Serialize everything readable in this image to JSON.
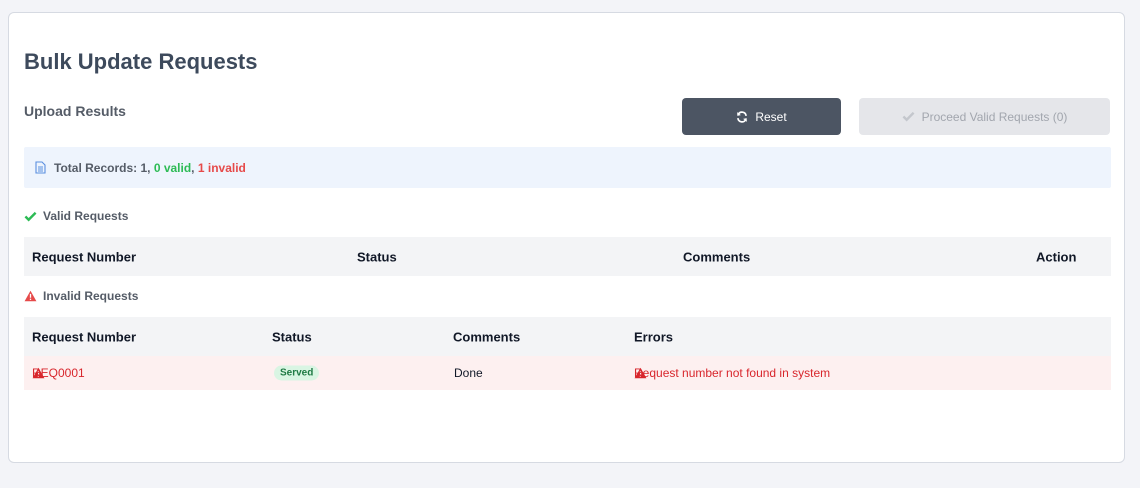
{
  "page": {
    "title": "Bulk Update Requests",
    "subtitle": "Upload Results"
  },
  "toolbar": {
    "reset_label": "Reset",
    "reset_icon": "refresh-icon",
    "proceed_label": "Proceed Valid Requests (0)",
    "proceed_icon": "check-icon",
    "proceed_disabled": true
  },
  "summary": {
    "icon": "document-icon",
    "prefix": "Total Records: 1,",
    "valid": "0 valid",
    "sep": ",",
    "invalid": "1 invalid"
  },
  "valid_section": {
    "title": "Valid Requests",
    "icon": "check-icon",
    "columns": [
      "Request Number",
      "Status",
      "Comments",
      "Action"
    ],
    "rows": []
  },
  "invalid_section": {
    "title": "Invalid Requests",
    "icon": "warning-icon",
    "columns": [
      "Request Number",
      "Status",
      "Comments",
      "Errors"
    ],
    "rows": [
      {
        "request_number": "REQ0001",
        "status": "Served",
        "comments": "Done",
        "error": "Request number not found in system"
      }
    ]
  },
  "colors": {
    "valid": "#2dbb55",
    "invalid": "#e64a4a",
    "reset_bg": "#4c5563",
    "summary_bg": "#eef4fd",
    "row_error_bg": "#fdf0f0"
  }
}
